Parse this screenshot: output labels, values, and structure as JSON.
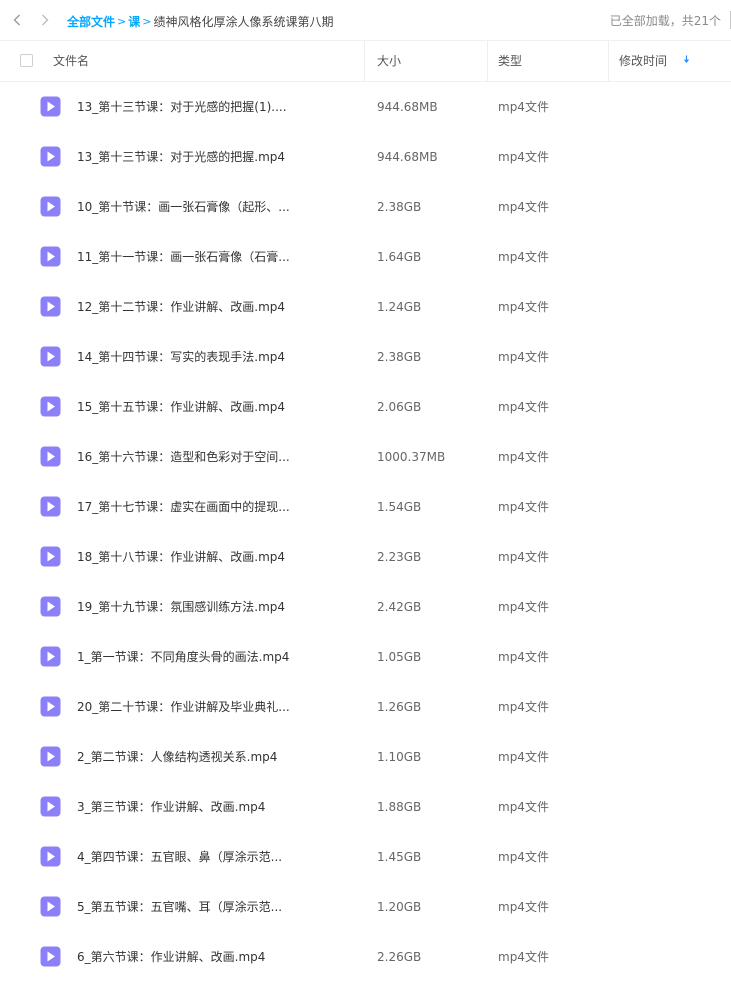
{
  "breadcrumb": {
    "root": "全部文件",
    "sep": ">",
    "parent": "课",
    "current": "绩神风格化厚涂人像系统课第八期"
  },
  "status": "已全部加载，共21个",
  "columns": {
    "name": "文件名",
    "size": "大小",
    "type": "类型",
    "modified": "修改时间"
  },
  "files": [
    {
      "name": "13_第十三节课：对于光感的把握(1)....",
      "size": "944.68MB",
      "type": "mp4文件"
    },
    {
      "name": "13_第十三节课：对于光感的把握.mp4",
      "size": "944.68MB",
      "type": "mp4文件"
    },
    {
      "name": "10_第十节课：画一张石膏像（起形、...",
      "size": "2.38GB",
      "type": "mp4文件"
    },
    {
      "name": "11_第十一节课：画一张石膏像（石膏...",
      "size": "1.64GB",
      "type": "mp4文件"
    },
    {
      "name": "12_第十二节课：作业讲解、改画.mp4",
      "size": "1.24GB",
      "type": "mp4文件"
    },
    {
      "name": "14_第十四节课：写实的表现手法.mp4",
      "size": "2.38GB",
      "type": "mp4文件"
    },
    {
      "name": "15_第十五节课：作业讲解、改画.mp4",
      "size": "2.06GB",
      "type": "mp4文件"
    },
    {
      "name": "16_第十六节课：造型和色彩对于空间...",
      "size": "1000.37MB",
      "type": "mp4文件"
    },
    {
      "name": "17_第十七节课：虚实在画面中的提现...",
      "size": "1.54GB",
      "type": "mp4文件"
    },
    {
      "name": "18_第十八节课：作业讲解、改画.mp4",
      "size": "2.23GB",
      "type": "mp4文件"
    },
    {
      "name": "19_第十九节课：氛围感训练方法.mp4",
      "size": "2.42GB",
      "type": "mp4文件"
    },
    {
      "name": "1_第一节课：不同角度头骨的画法.mp4",
      "size": "1.05GB",
      "type": "mp4文件"
    },
    {
      "name": "20_第二十节课：作业讲解及毕业典礼...",
      "size": "1.26GB",
      "type": "mp4文件"
    },
    {
      "name": "2_第二节课：人像结构透视关系.mp4",
      "size": "1.10GB",
      "type": "mp4文件"
    },
    {
      "name": "3_第三节课：作业讲解、改画.mp4",
      "size": "1.88GB",
      "type": "mp4文件"
    },
    {
      "name": "4_第四节课：五官眼、鼻（厚涂示范...",
      "size": "1.45GB",
      "type": "mp4文件"
    },
    {
      "name": "5_第五节课：五官嘴、耳（厚涂示范...",
      "size": "1.20GB",
      "type": "mp4文件"
    },
    {
      "name": "6_第六节课：作业讲解、改画.mp4",
      "size": "2.26GB",
      "type": "mp4文件"
    }
  ],
  "icons": {
    "back": "chevron-left-icon",
    "forward": "chevron-right-icon",
    "file": "video-file-icon",
    "sort": "sort-desc-icon"
  },
  "colors": {
    "accent": "#06a7ff",
    "file_icon": "#8b80f9"
  }
}
